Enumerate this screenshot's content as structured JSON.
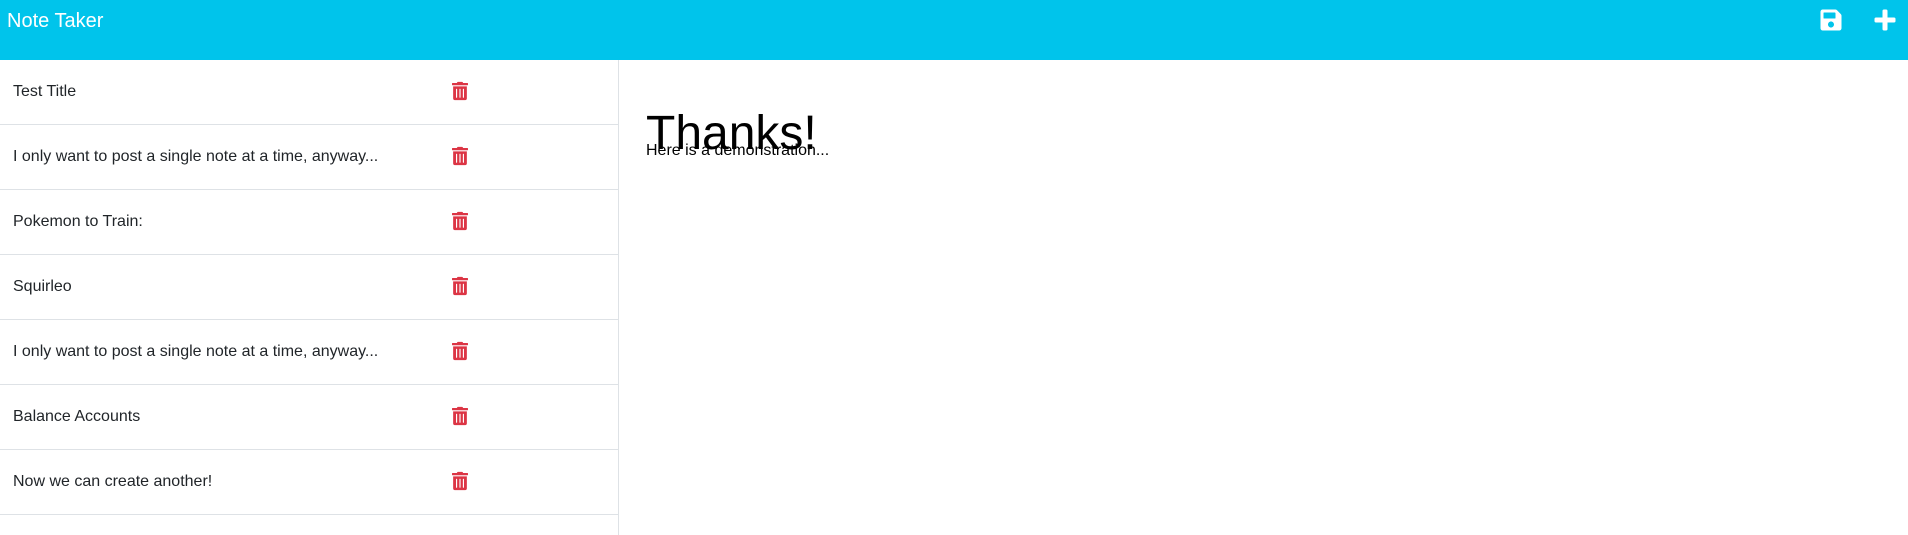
{
  "app": {
    "title": "Note Taker"
  },
  "toolbar": {
    "save_icon": "save-icon",
    "new_icon": "plus-icon"
  },
  "colors": {
    "navbar": "#00c4eb",
    "delete": "#dc3545",
    "divider": "#dee2e6"
  },
  "notes": [
    {
      "title": "Test Title"
    },
    {
      "title": "I only want to post a single note at a time, anyway..."
    },
    {
      "title": "Pokemon to Train:"
    },
    {
      "title": "Squirleo"
    },
    {
      "title": "I only want to post a single note at a time, anyway..."
    },
    {
      "title": "Balance Accounts"
    },
    {
      "title": "Now we can create another!"
    }
  ],
  "active_note": {
    "title": "Thanks!",
    "text": "Here is a demonstration..."
  }
}
